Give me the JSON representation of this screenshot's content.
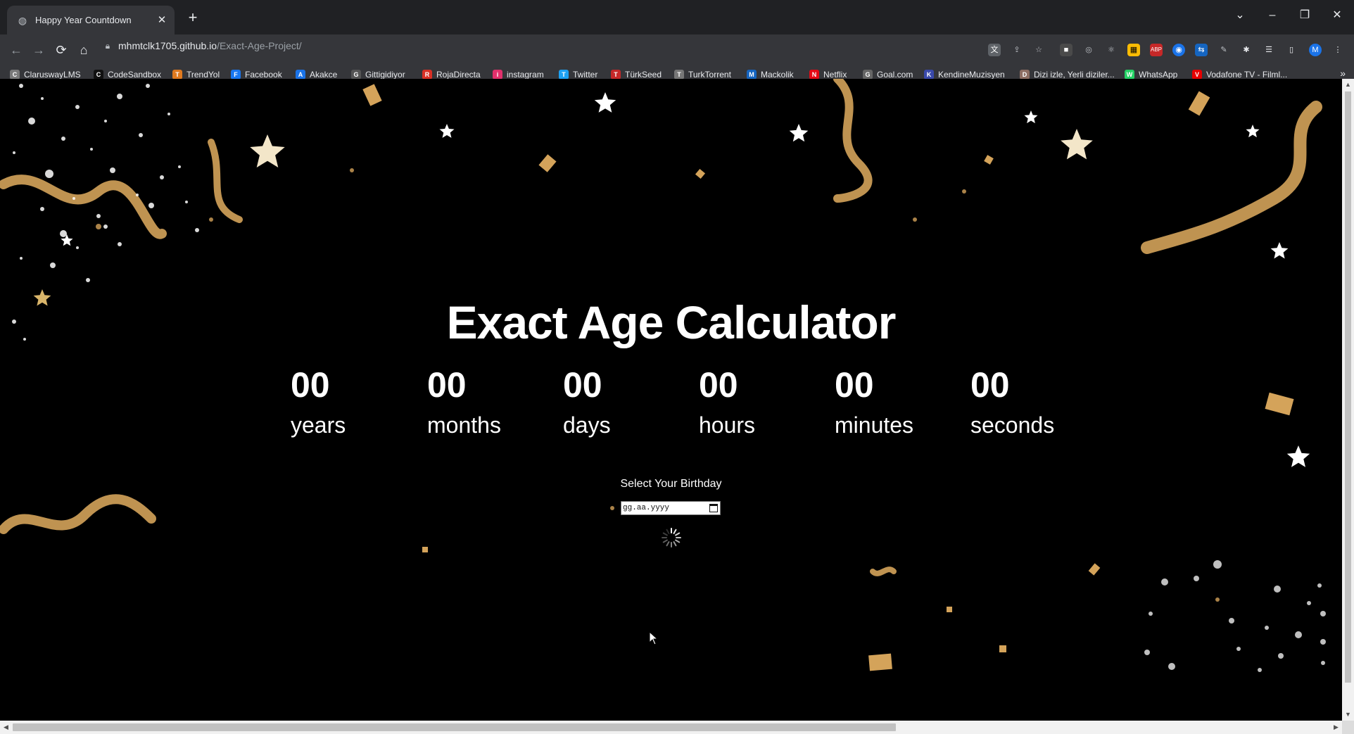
{
  "browser": {
    "tab": {
      "title": "Happy Year Countdown"
    },
    "url": {
      "host": "mhmtclk1705.github.io",
      "path": "/Exact-Age-Project/"
    },
    "profile_initial": "M"
  },
  "bookmarks": [
    {
      "label": "ClaruswayLMS",
      "icon": "clarusway-icon",
      "color": "#7a7a7a"
    },
    {
      "label": "CodeSandbox",
      "icon": "codesandbox-icon",
      "color": "#111111"
    },
    {
      "label": "TrendYol",
      "icon": "trendyol-icon",
      "color": "#e07a1f"
    },
    {
      "label": "Facebook",
      "icon": "facebook-icon",
      "color": "#1877f2"
    },
    {
      "label": "Akakce",
      "icon": "akakce-icon",
      "color": "#1a73e8"
    },
    {
      "label": "Gittigidiyor",
      "icon": "gittigidiyor-icon",
      "color": "#555555"
    },
    {
      "label": "RojaDirecta",
      "icon": "rojadirecta-icon",
      "color": "#d93025"
    },
    {
      "label": "instagram",
      "icon": "instagram-icon",
      "color": "#e1306c"
    },
    {
      "label": "Twitter",
      "icon": "twitter-icon",
      "color": "#1da1f2"
    },
    {
      "label": "TürkSeed",
      "icon": "turkseed-icon",
      "color": "#c62828"
    },
    {
      "label": "TurkTorrent",
      "icon": "turktorrent-icon",
      "color": "#777777"
    },
    {
      "label": "Mackolik",
      "icon": "mackolik-icon",
      "color": "#1565c0"
    },
    {
      "label": "Netflix",
      "icon": "netflix-icon",
      "color": "#e50914"
    },
    {
      "label": "Goal.com",
      "icon": "goal-icon",
      "color": "#666666"
    },
    {
      "label": "KendineMuzisyen",
      "icon": "kendinemuzisyen-icon",
      "color": "#3949ab"
    },
    {
      "label": "Dizi izle, Yerli diziler...",
      "icon": "dizi-icon",
      "color": "#8d6e63"
    },
    {
      "label": "WhatsApp",
      "icon": "whatsapp-icon",
      "color": "#25d366"
    },
    {
      "label": "Vodafone TV - Filml...",
      "icon": "vodafone-icon",
      "color": "#e60000"
    }
  ],
  "page": {
    "title": "Exact Age Calculator",
    "units": [
      {
        "value": "00",
        "label": "years"
      },
      {
        "value": "00",
        "label": "months"
      },
      {
        "value": "00",
        "label": "days"
      },
      {
        "value": "00",
        "label": "hours"
      },
      {
        "value": "00",
        "label": "minutes"
      },
      {
        "value": "00",
        "label": "seconds"
      }
    ],
    "picker_label": "Select Your Birthday",
    "date_placeholder": "gg.aa.yyyy"
  },
  "colors": {
    "accent_gold": "#d4a35a",
    "background": "#000000",
    "text": "#ffffff"
  }
}
